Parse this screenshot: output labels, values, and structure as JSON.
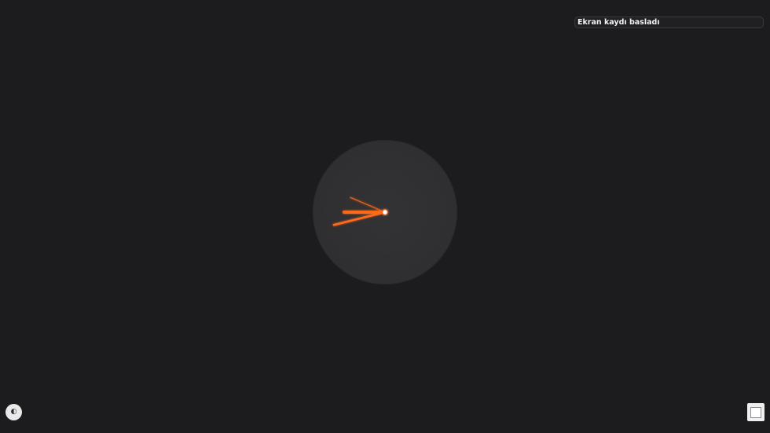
{
  "notification": {
    "text": "Ekran kaydı basladı"
  },
  "clock": {
    "hour_hand_angle_deg": 256,
    "minute_hand_angle_deg": 270,
    "second_hand_angle_deg": 293,
    "hand_color": "#ff6a1a",
    "center_color": "#ffffff",
    "face_color": "#302f32"
  },
  "theme_toggle": {
    "icon": "half-circle-icon",
    "glyph": "◐"
  },
  "stop_button": {
    "icon": "stop-square-icon"
  },
  "colors": {
    "background": "#1c1b1d",
    "accent": "#ff6a1a"
  }
}
